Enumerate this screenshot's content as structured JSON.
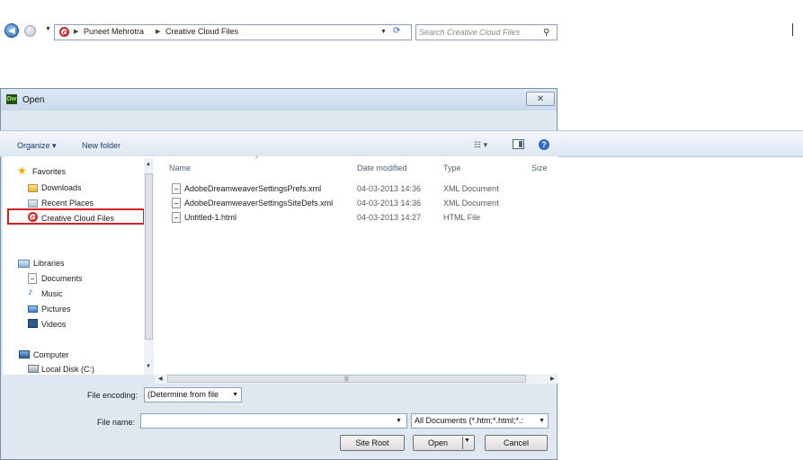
{
  "dialog": {
    "title": "Open",
    "app_icon_text": "Dw",
    "close_glyph": "✕"
  },
  "address_bar": {
    "crumbs": [
      "Puneet Mehrotra",
      "Creative Cloud Files"
    ],
    "search_placeholder": "Search Creative Cloud Files"
  },
  "toolbar": {
    "organize_label": "Organize ▾",
    "new_folder_label": "New folder",
    "views_label": "☷ ▾"
  },
  "nav_pane": {
    "favorites_header": "Favorites",
    "favorites": [
      "Downloads",
      "Recent Places",
      "Creative Cloud Files"
    ],
    "libraries_header": "Libraries",
    "libraries": [
      "Documents",
      "Music",
      "Pictures",
      "Videos"
    ],
    "computer_header": "Computer",
    "computer": [
      "Local Disk (C:)"
    ]
  },
  "file_list": {
    "columns": [
      "Name",
      "Date modified",
      "Type",
      "Size"
    ],
    "rows": [
      {
        "name": "AdobeDreamweaverSettingsPrefs.xml",
        "date": "04-03-2013 14:36",
        "type": "XML Document"
      },
      {
        "name": "AdobeDreamweaverSettingsSiteDefs.xml",
        "date": "04-03-2013 14:36",
        "type": "XML Document"
      },
      {
        "name": "Untitled-1.html",
        "date": "04-03-2013 14:27",
        "type": "HTML File"
      }
    ]
  },
  "bottom": {
    "encoding_label": "File encoding:",
    "encoding_value": "(Determine from file",
    "filename_label": "File name:",
    "filename_value": "",
    "filetype_value": "All Documents (*.htm;*.html;*.:",
    "site_root_label": "Site Root",
    "open_label": "Open",
    "cancel_label": "Cancel"
  },
  "colors": {
    "highlight": "#d51f25",
    "creative_cloud": "#d51f25"
  }
}
